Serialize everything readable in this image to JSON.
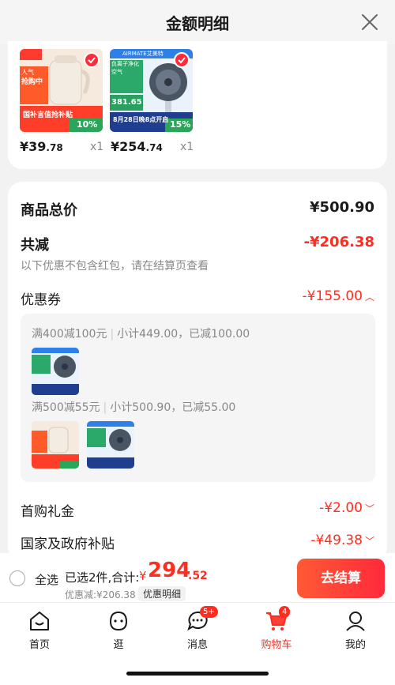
{
  "header": {
    "title": "金额明细"
  },
  "products": [
    {
      "price_int": "¥39",
      "price_dec": ".78",
      "qty": "x1",
      "badge_top": "人气",
      "badge_main": "抢购中",
      "banner": "国补言值抢补贴",
      "discount": "10%"
    },
    {
      "price_int": "¥254",
      "price_dec": ".74",
      "qty": "x1",
      "brand": "AIRMATE艾美特",
      "headline": "负离子净化空气",
      "price_tag": "381.65",
      "date_text": "8月28日晚8点开启",
      "discount": "15%"
    }
  ],
  "summary": {
    "total_label": "商品总价",
    "total_value": "¥500.90",
    "reduce_label": "共减",
    "reduce_value": "-¥206.38",
    "reduce_note": "以下优惠不包含红包，请在结算页查看",
    "coupon_label": "优惠券",
    "coupon_value": "-¥155.00",
    "coupon_rules": [
      {
        "rule": "满400减100元",
        "detail": "小计449.00，已减100.00"
      },
      {
        "rule": "满500减55元",
        "detail": "小计500.90，已减55.00"
      }
    ],
    "first_label": "首购礼金",
    "first_value": "-¥2.00",
    "gov_label": "国家及政府补贴",
    "gov_value": "-¥49.38"
  },
  "bottom": {
    "select_all": "全选",
    "selected": "已选2件,合计:",
    "total_yen": "¥",
    "total_int": "294",
    "total_dec": ".52",
    "discount_line": "优惠减:¥206.38",
    "detail_chip": "优惠明细",
    "checkout": "去结算"
  },
  "tabbar": [
    {
      "label": "首页"
    },
    {
      "label": "逛"
    },
    {
      "label": "消息",
      "badge": "5+"
    },
    {
      "label": "购物车",
      "badge": "4"
    },
    {
      "label": "我的"
    }
  ],
  "colors": {
    "accent": "#ff2d1f",
    "checkout_start": "#ff5a36",
    "checkout_end": "#ff2a3a"
  }
}
